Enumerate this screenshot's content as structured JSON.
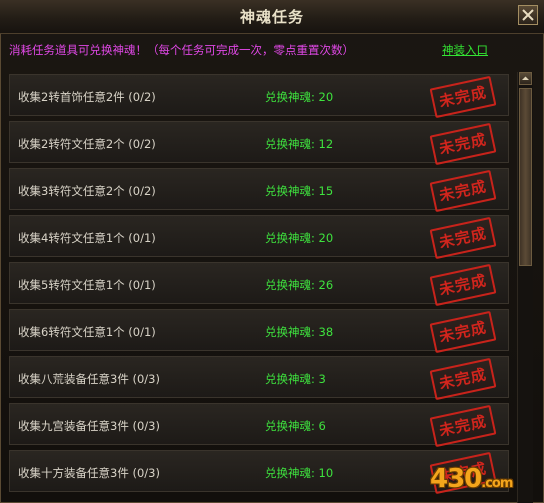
{
  "window": {
    "title": "神魂任务",
    "close_icon": "close-icon"
  },
  "header": {
    "notice": "消耗任务道具可兑换神魂！（每个任务可完成一次，零点重置次数）",
    "shop_link": "神装入口"
  },
  "tasks": [
    {
      "name": "收集2转首饰任意2件 (0/2)",
      "reward": "兑换神魂: 20",
      "status": "未完成"
    },
    {
      "name": "收集2转符文任意2个 (0/2)",
      "reward": "兑换神魂: 12",
      "status": "未完成"
    },
    {
      "name": "收集3转符文任意2个 (0/2)",
      "reward": "兑换神魂: 15",
      "status": "未完成"
    },
    {
      "name": "收集4转符文任意1个 (0/1)",
      "reward": "兑换神魂: 20",
      "status": "未完成"
    },
    {
      "name": "收集5转符文任意1个 (0/1)",
      "reward": "兑换神魂: 26",
      "status": "未完成"
    },
    {
      "name": "收集6转符文任意1个 (0/1)",
      "reward": "兑换神魂: 38",
      "status": "未完成"
    },
    {
      "name": "收集八荒装备任意3件 (0/3)",
      "reward": "兑换神魂: 3",
      "status": "未完成"
    },
    {
      "name": "收集九宫装备任意3件 (0/3)",
      "reward": "兑换神魂: 6",
      "status": "未完成"
    },
    {
      "name": "收集十方装备任意3件 (0/3)",
      "reward": "兑换神魂: 10",
      "status": "未完成"
    }
  ],
  "watermark": {
    "main": "430",
    "suffix": ".com"
  },
  "colors": {
    "notice": "#e048e6",
    "link": "#33e533",
    "reward": "#3ee33e",
    "stamp": "#c8231b"
  }
}
